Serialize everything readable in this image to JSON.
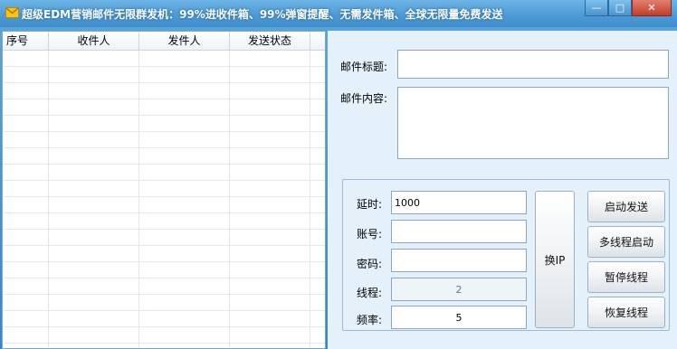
{
  "window": {
    "title": "超级EDM营销邮件无限群发机：99%进收件箱、99%弹窗提醒、无需发件箱、全球无限量免费发送",
    "minimize_icon": "minimize-icon",
    "maximize_icon": "maximize-icon",
    "close_icon": "close-icon"
  },
  "table": {
    "columns": [
      "序号",
      "收件人",
      "发件人",
      "发送状态"
    ],
    "rows": []
  },
  "mail": {
    "subject_label": "邮件标题:",
    "subject_value": "",
    "content_label": "邮件内容:",
    "content_value": ""
  },
  "settings": {
    "delay_label": "延时:",
    "delay_value": "1000",
    "account_label": "账号:",
    "account_value": "",
    "password_label": "密码:",
    "password_value": "",
    "threads_label": "线程:",
    "threads_value": "2",
    "rate_label": "频率:",
    "rate_value": "5"
  },
  "buttons": {
    "change_ip": "换IP",
    "start_send": "启动发送",
    "multi_thread_start": "多线程启动",
    "pause_threads": "暂停线程",
    "resume_threads": "恢复线程"
  },
  "colors": {
    "titlebar": "#4d9bd6",
    "panel_bg": "#e4f1fb"
  }
}
